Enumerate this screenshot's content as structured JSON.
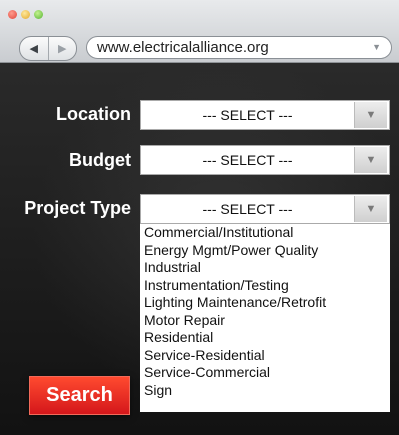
{
  "browser": {
    "url": "www.electricalalliance.org",
    "back_icon": "chevron-left",
    "forward_icon": "chevron-right",
    "url_menu_icon": "triangle-down"
  },
  "form": {
    "location_label": "Location",
    "location_value": "--- SELECT ---",
    "budget_label": "Budget",
    "budget_value": "--- SELECT ---",
    "project_type_label": "Project Type",
    "project_type_value": "--- SELECT ---",
    "project_type_options": [
      "Commercial/Institutional",
      "Energy Mgmt/Power Quality",
      "Industrial",
      "Instrumentation/Testing",
      "Lighting Maintenance/Retrofit",
      "Motor Repair",
      "Residential",
      "Service-Residential",
      "Service-Commercial",
      "Sign"
    ],
    "search_label": "Search"
  },
  "colors": {
    "search_button": "#e0231d",
    "background": "#1a1a1a"
  }
}
